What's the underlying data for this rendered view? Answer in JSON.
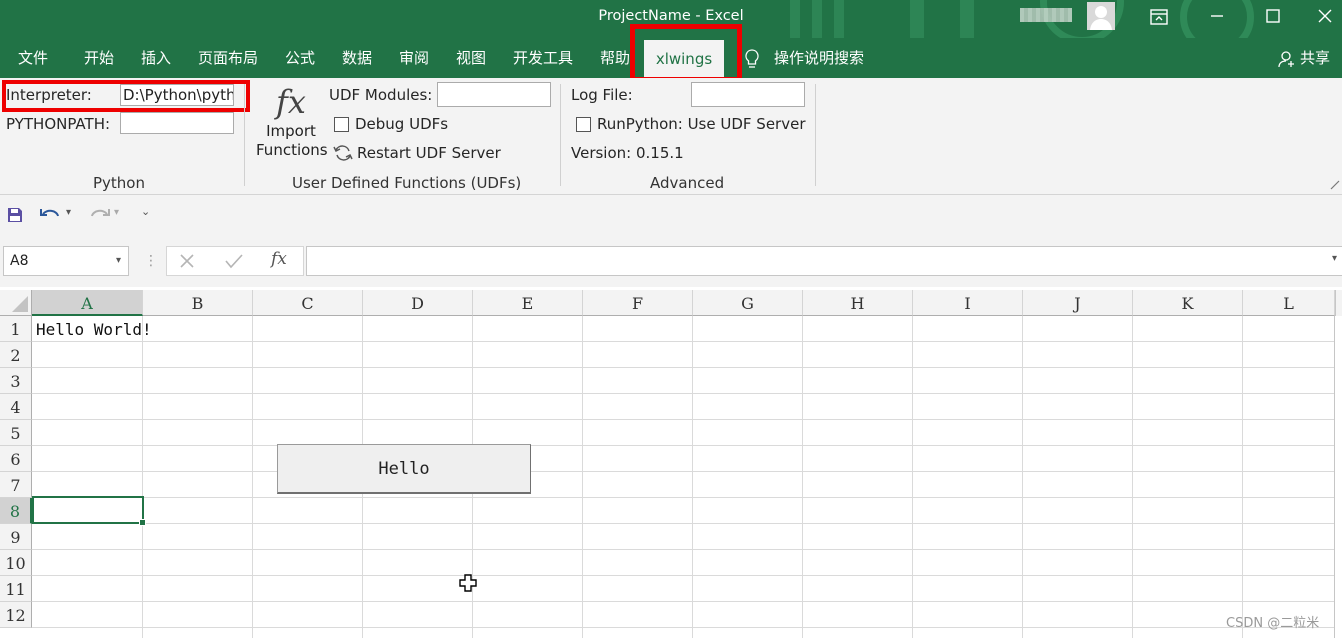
{
  "title_bar": {
    "title": "ProjectName  -  Excel"
  },
  "tabs": [
    "文件",
    "开始",
    "插入",
    "页面布局",
    "公式",
    "数据",
    "审阅",
    "视图",
    "开发工具",
    "帮助",
    "xlwings"
  ],
  "active_tab": "xlwings",
  "search_placeholder": "操作说明搜索",
  "share_label": "共享",
  "ribbon": {
    "python": {
      "interpreter_label": "Interpreter:",
      "interpreter_value": "D:\\Python\\pyth",
      "pythonpath_label": "PYTHONPATH:",
      "pythonpath_value": "",
      "group_label": "Python"
    },
    "udf": {
      "fx_glyph": "fx",
      "import_label_1": "Import",
      "import_label_2": "Functions",
      "modules_label": "UDF Modules:",
      "modules_value": "",
      "debug_label": "Debug UDFs",
      "restart_label": "Restart UDF Server",
      "group_label": "User Defined Functions (UDFs)"
    },
    "advanced": {
      "logfile_label": "Log File:",
      "logfile_value": "",
      "runpython_label": "RunPython: Use UDF Server",
      "version_label": "Version: 0.15.1",
      "group_label": "Advanced"
    }
  },
  "formula_bar": {
    "name_box": "A8",
    "formula": ""
  },
  "sheet": {
    "columns": [
      "A",
      "B",
      "C",
      "D",
      "E",
      "F",
      "G",
      "H",
      "I",
      "J",
      "K",
      "L"
    ],
    "rows": [
      "1",
      "2",
      "3",
      "4",
      "5",
      "6",
      "7",
      "8",
      "9",
      "10",
      "11",
      "12"
    ],
    "selected_cell": "A8",
    "a1": "Hello World!",
    "button_label": "Hello"
  },
  "watermark": "CSDN @二粒米",
  "colors": {
    "excel_green": "#217346",
    "highlight_red": "#e00000"
  }
}
